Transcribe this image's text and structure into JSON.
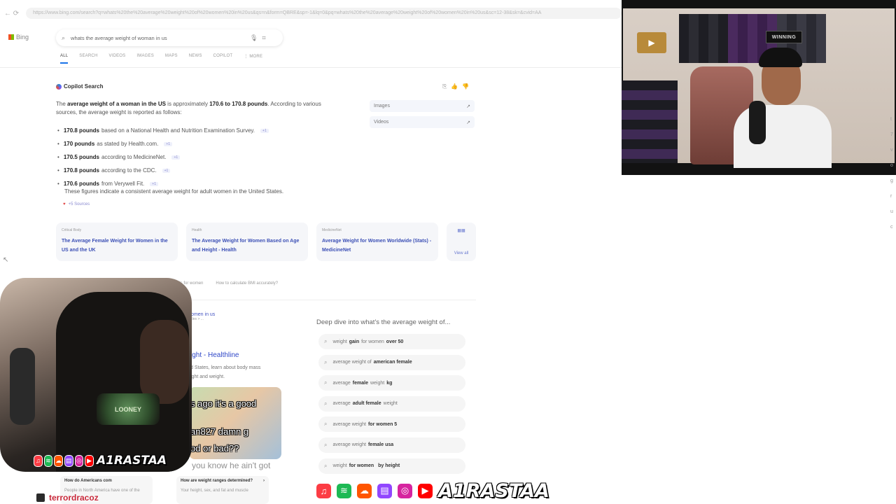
{
  "browser": {
    "nav": "← ⟳",
    "url": "https://www.bing.com/search?q=whats%20the%20average%20weight%20of%20women%20in%20us&qs=n&form=QBRE&sp=-1&lq=0&pq=whats%20the%20average%20weight%20of%20women%20in%20us&sc=12-38&sk=&cvid=AA"
  },
  "bing": {
    "logo": "Bing",
    "query": "whats the average weight of woman in us",
    "tabs": [
      "ALL",
      "SEARCH",
      "VIDEOS",
      "IMAGES",
      "MAPS",
      "NEWS",
      "COPILOT",
      "⋮ MORE"
    ]
  },
  "copilot": {
    "header": "Copilot Search",
    "intro_pre": "The ",
    "intro_b1": "average weight of a woman in the US",
    "intro_mid": " is approximately ",
    "intro_b2": "170.6 to 170.8 pounds",
    "intro_post": ". According to various sources, the average weight is reported as follows:",
    "bullets": [
      {
        "bold": "170.8 pounds",
        "text": "based on a National Health and Nutrition Examination Survey.",
        "cite": "+1"
      },
      {
        "bold": "170 pounds",
        "text": "as stated by Health.com.",
        "cite": "+1"
      },
      {
        "bold": "170.5 pounds",
        "text": "according to MedicineNet.",
        "cite": "+1"
      },
      {
        "bold": "170.8 pounds",
        "text": "according to the CDC.",
        "cite": "+1"
      },
      {
        "bold": "170.6 pounds",
        "text": "from Verywell Fit.",
        "cite": "+1"
      }
    ],
    "summary": "These figures indicate a consistent average weight for adult women in the United States.",
    "sources": "+5 Sources",
    "feedback_icons": [
      "⎘",
      "👍",
      "👎"
    ]
  },
  "media_links": [
    "Images",
    "Videos"
  ],
  "cards": [
    {
      "source": "Critical Body",
      "title": "The Average Female Weight for Women in the US and the UK"
    },
    {
      "source": "Health",
      "title": "The Average Weight for Women Based on Age and Height - Health"
    },
    {
      "source": "MedicineNet",
      "title": "Average Weight for Women Worldwide (Stats) - MedicineNet"
    }
  ],
  "view_all": "View all",
  "related_chips": [
    "weight trends for women",
    "How to calculate BMI accurately?"
  ],
  "result": {
    "breadcrumb": "women in us",
    "sub": "rticles > ...",
    "title": "ight - Healthline",
    "snippet_1": "d States, learn about body mass",
    "snippet_2": "ight and weight."
  },
  "thumb": {
    "overlay_1": "s ago it's a good",
    "overlay_2": "an827 damn g",
    "overlay_3": "od or bad??",
    "overlay_4": "you know he ain't got"
  },
  "people_also_ask": [
    {
      "q": "How do Americans com",
      "a": "People in North America have one of the"
    },
    {
      "q": "How are weight ranges determined?",
      "a": "Your height, sex, and fat and muscle"
    }
  ],
  "deep_dive": {
    "title": "Deep dive into what's the average weight of...",
    "items": [
      {
        "pre": "weight",
        "bold": "gain",
        "post": "for women",
        "bold2": "over 50"
      },
      {
        "pre": "average weight of",
        "bold": "american female",
        "post": "",
        "bold2": ""
      },
      {
        "pre": "average",
        "bold": "female",
        "post": "weight",
        "bold2": "kg"
      },
      {
        "pre": "average",
        "bold": "adult female",
        "post": "weight",
        "bold2": ""
      },
      {
        "pre": "average weight",
        "bold": "for women 5",
        "post": "",
        "bold2": ""
      },
      {
        "pre": "average weight",
        "bold": "female usa",
        "post": "",
        "bold2": ""
      },
      {
        "pre": "weight",
        "bold": "for women",
        "post": "",
        "bold2": "by height"
      }
    ]
  },
  "stream": {
    "winning_sign": "WINNING",
    "brand": "A1RASTAA",
    "chat_user": "terrordracoz",
    "shirt_text": "LOONEY",
    "social_icons": [
      "apple-music",
      "spotify",
      "soundcloud",
      "twitch",
      "instagram",
      "youtube"
    ],
    "right_strip": [
      "t",
      "7",
      "v",
      "o",
      "g",
      "r",
      "u",
      "c"
    ]
  },
  "colors": {
    "link": "#3b4fb5",
    "accent": "#1a73e8",
    "chat_name": "#c8283a"
  }
}
